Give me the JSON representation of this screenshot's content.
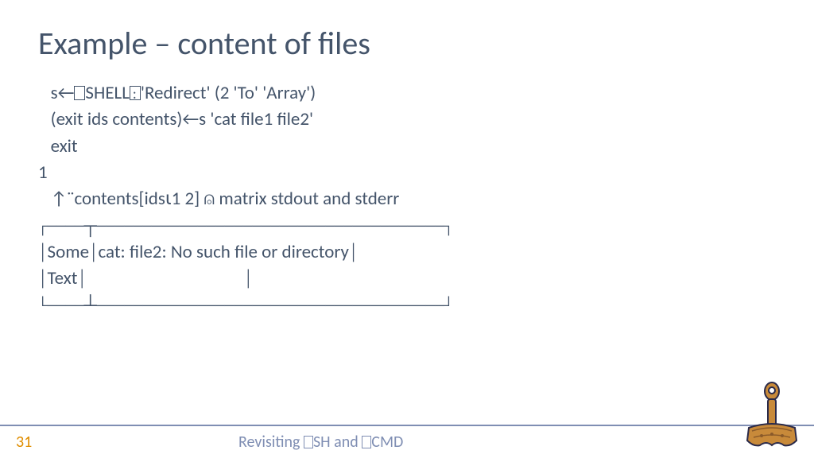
{
  "title": "Example – content of files",
  "code": {
    "line1_pre": "   s←",
    "line1_mid": "SHELL",
    "line1_post": "'Redirect' (2 'To' 'Array')",
    "line2": "   (exit ids contents)←s 'cat file1 file2'",
    "line3": "   exit",
    "line4": "1",
    "line5": "   ↑¨contents[ids⍳1 2] ⍝ matrix stdout and stderr",
    "box1": "┌────┬──────────────────────────────────────┐",
    "box2": "│Some│cat: file2: No such file or directory│",
    "box3": "│Text│                                      │",
    "box4": "└────┴──────────────────────────────────────┘"
  },
  "footer": {
    "page": "31",
    "title_pre": "Revisiting ",
    "title_mid": "SH and ",
    "title_post": "CMD"
  }
}
